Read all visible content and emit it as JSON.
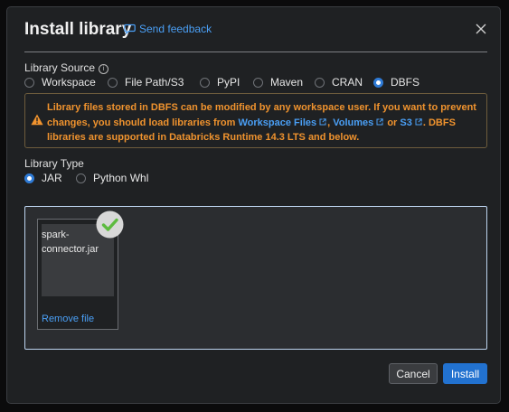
{
  "dialog": {
    "title": "Install library",
    "feedback_label": "Send feedback"
  },
  "library_source": {
    "label": "Library Source",
    "options": [
      "Workspace",
      "File Path/S3",
      "PyPI",
      "Maven",
      "CRAN",
      "DBFS"
    ],
    "selected": "DBFS"
  },
  "warning": {
    "text_1": "Library files stored in DBFS can be modified by any workspace user. If you want to prevent changes, you should load libraries from ",
    "link_workspace": "Workspace Files",
    "sep_1": ", ",
    "link_volumes": "Volumes",
    "sep_2": " or ",
    "link_s3": "S3",
    "text_2": ". DBFS libraries are supported in Databricks Runtime 14.3 LTS and below."
  },
  "library_type": {
    "label": "Library Type",
    "options": [
      "JAR",
      "Python Whl"
    ],
    "selected": "JAR"
  },
  "upload": {
    "file_name": "spark-\nconnector.jar",
    "remove_label": "Remove file"
  },
  "actions": {
    "cancel_label": "Cancel",
    "install_label": "Install"
  },
  "colors": {
    "accent": "#2272d0",
    "link": "#4a9ff5",
    "warning": "#f0932e",
    "success": "#6cc644"
  },
  "icons": [
    "chat-bubble-icon",
    "close-icon",
    "info-icon",
    "warning-triangle-icon",
    "external-link-icon",
    "check-circle-icon"
  ]
}
